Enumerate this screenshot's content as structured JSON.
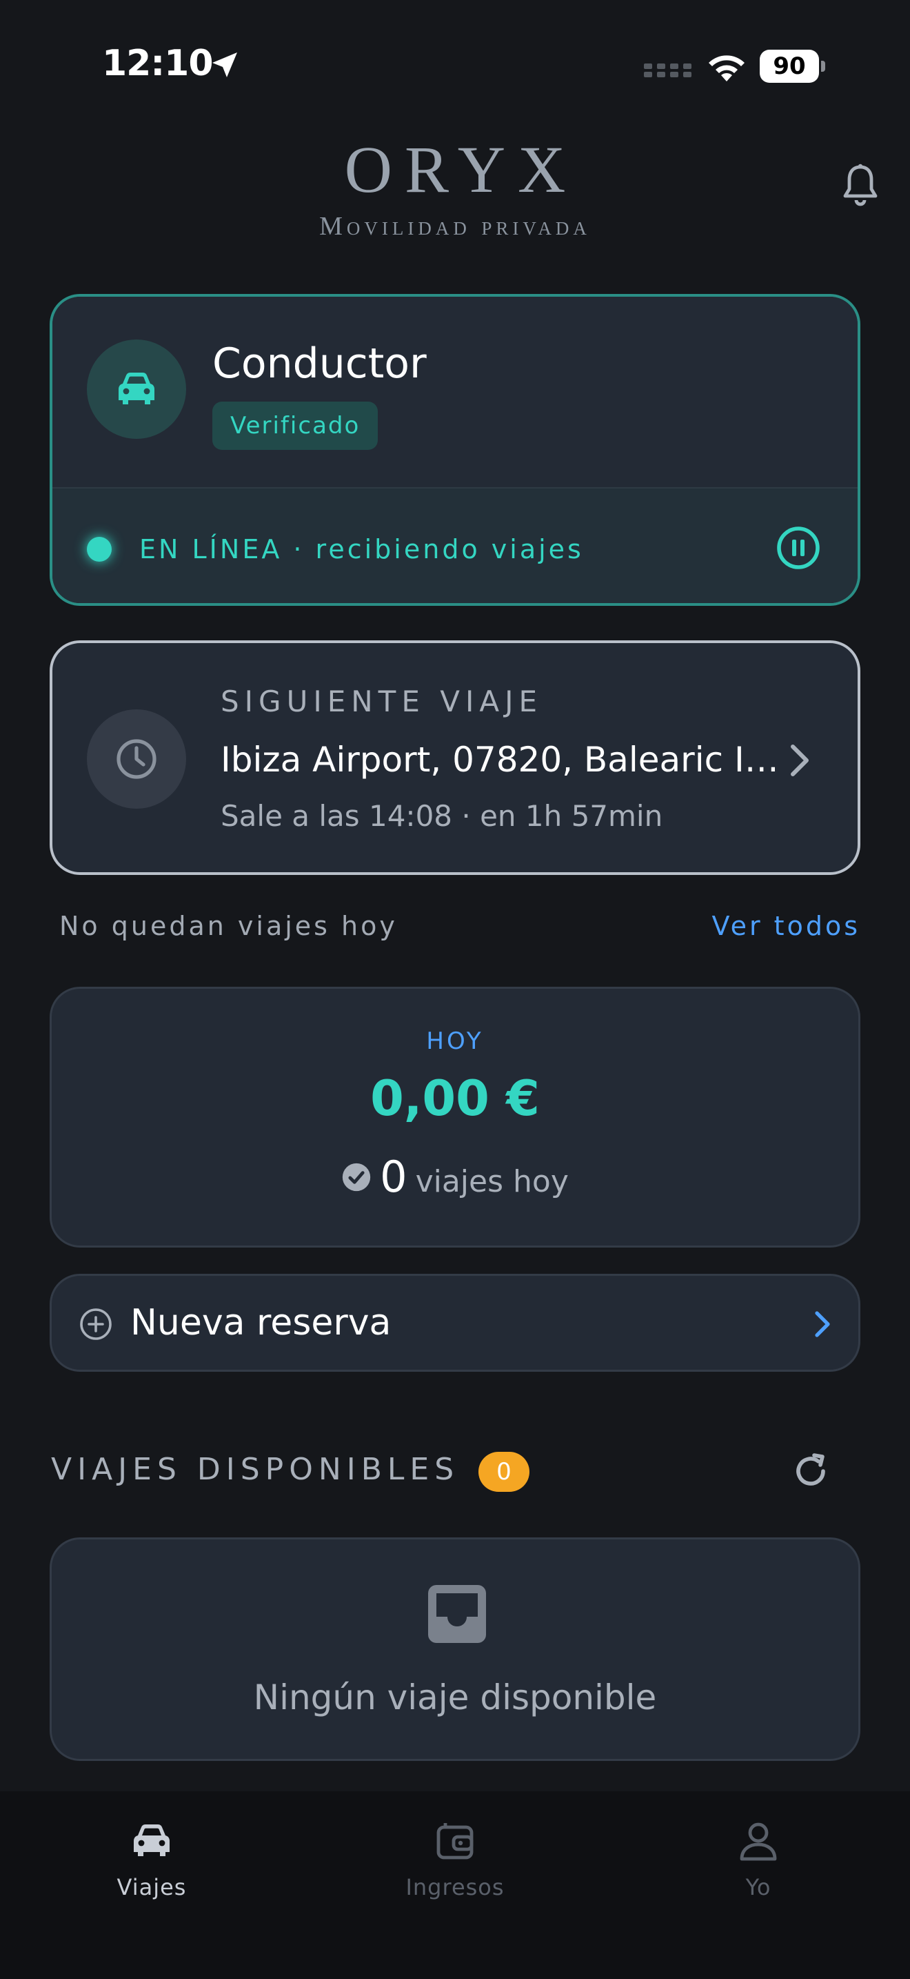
{
  "status_bar": {
    "time": "12:10",
    "battery": "90"
  },
  "brand": {
    "name": "ORYX",
    "tagline": "Movilidad privada"
  },
  "driver": {
    "role": "Conductor",
    "badge": "Verificado",
    "status": "EN LÍNEA · recibiendo viajes"
  },
  "next_trip": {
    "label": "SIGUIENTE VIAJE",
    "destination": "Ibiza Airport, 07820, Balearic Isl...",
    "departure": "Sale a las 14:08 · en 1h 57min"
  },
  "trips_info": {
    "remaining": "No quedan viajes hoy",
    "see_all": "Ver todos"
  },
  "earnings": {
    "label": "HOY",
    "amount": "0,00 €",
    "trip_count": "0",
    "trip_text": "viajes hoy"
  },
  "booking": {
    "label": "Nueva reserva"
  },
  "available": {
    "title": "VIAJES DISPONIBLES",
    "count": "0",
    "empty": "Ningún viaje disponible"
  },
  "tabs": [
    {
      "label": "Viajes",
      "active": true
    },
    {
      "label": "Ingresos",
      "active": false
    },
    {
      "label": "Yo",
      "active": false
    }
  ],
  "colors": {
    "accent": "#34d6c2",
    "link": "#4ea0ff",
    "badge": "#f5a623",
    "background": "#15171b"
  }
}
